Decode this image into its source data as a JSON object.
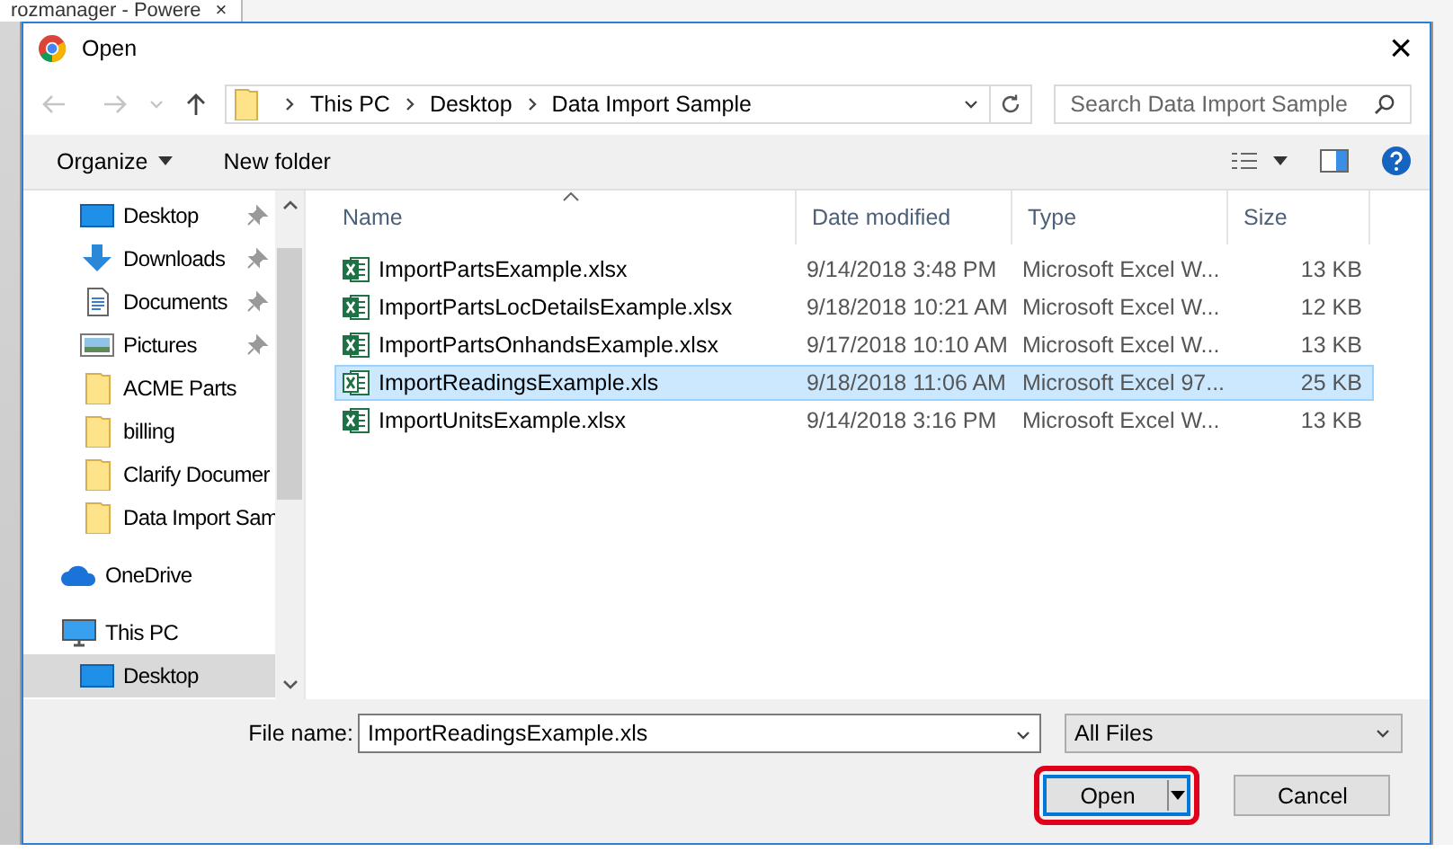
{
  "background_tab": {
    "title": "rozmanager - Powere",
    "close": "×"
  },
  "window": {
    "title": "Open",
    "close": "×"
  },
  "navigation": {
    "back_disabled": true,
    "forward_disabled": true,
    "breadcrumbs": [
      "This PC",
      "Desktop",
      "Data Import Sample"
    ],
    "search": {
      "placeholder": "Search Data Import Sample"
    }
  },
  "toolbar": {
    "organize": "Organize",
    "new_folder": "New folder"
  },
  "sidebar": {
    "quick_access": [
      {
        "label": "Desktop",
        "kind": "desktop",
        "pinned": true,
        "selected": false
      },
      {
        "label": "Downloads",
        "kind": "downloads",
        "pinned": true,
        "selected": false
      },
      {
        "label": "Documents",
        "kind": "documents",
        "pinned": true,
        "selected": false
      },
      {
        "label": "Pictures",
        "kind": "pictures",
        "pinned": true,
        "selected": false
      },
      {
        "label": "ACME Parts",
        "kind": "folder",
        "pinned": false,
        "selected": false
      },
      {
        "label": "billing",
        "kind": "folder",
        "pinned": false,
        "selected": false
      },
      {
        "label": "Clarify Documer",
        "kind": "folder",
        "pinned": false,
        "selected": false
      },
      {
        "label": "Data Import Sam",
        "kind": "folder",
        "pinned": false,
        "selected": false
      }
    ],
    "locations": [
      {
        "label": "OneDrive",
        "kind": "cloud",
        "pinned": false,
        "selected": false
      },
      {
        "label": "This PC",
        "kind": "computer",
        "pinned": false,
        "selected": false,
        "children": [
          {
            "label": "Desktop",
            "kind": "desktop",
            "pinned": false,
            "selected": true
          }
        ]
      }
    ]
  },
  "table": {
    "columns": [
      {
        "label": "Name",
        "sorted": true
      },
      {
        "label": "Date modified",
        "sorted": false
      },
      {
        "label": "Type",
        "sorted": false
      },
      {
        "label": "Size",
        "sorted": false
      }
    ],
    "rows": [
      {
        "name": "ImportPartsExample.xlsx",
        "date": "9/14/2018 3:48 PM",
        "type": "Microsoft Excel W...",
        "size": "13 KB",
        "kind": "xlsx",
        "selected": false
      },
      {
        "name": "ImportPartsLocDetailsExample.xlsx",
        "date": "9/18/2018 10:21 AM",
        "type": "Microsoft Excel W...",
        "size": "12 KB",
        "kind": "xlsx",
        "selected": false
      },
      {
        "name": "ImportPartsOnhandsExample.xlsx",
        "date": "9/17/2018 10:10 AM",
        "type": "Microsoft Excel W...",
        "size": "13 KB",
        "kind": "xlsx",
        "selected": false
      },
      {
        "name": "ImportReadingsExample.xls",
        "date": "9/18/2018 11:06 AM",
        "type": "Microsoft Excel 97...",
        "size": "25 KB",
        "kind": "xls",
        "selected": true
      },
      {
        "name": "ImportUnitsExample.xlsx",
        "date": "9/14/2018 3:16 PM",
        "type": "Microsoft Excel W...",
        "size": "13 KB",
        "kind": "xlsx",
        "selected": false
      }
    ]
  },
  "footer": {
    "file_name_label": "File name:",
    "file_name": "ImportReadingsExample.xls",
    "filter": "All Files",
    "buttons": [
      {
        "label": "Open",
        "kind": "split",
        "highlighted": true
      },
      {
        "label": "Cancel",
        "kind": "plain",
        "highlighted": false
      }
    ]
  }
}
